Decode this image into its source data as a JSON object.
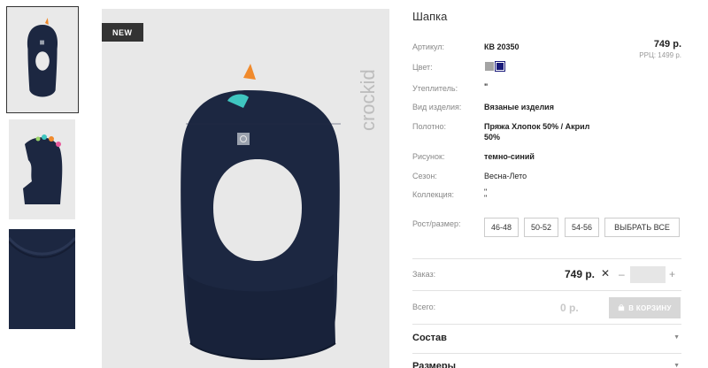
{
  "product": {
    "title": "Шапка",
    "badge": "NEW",
    "brand": "crockid",
    "price": "749 р.",
    "rrp": "РРЦ: 1499 р."
  },
  "attributes": [
    {
      "label": "Артикул:",
      "value": "КВ 20350"
    },
    {
      "label": "Цвет:",
      "value": ""
    },
    {
      "label": "Утеплитель:",
      "value": "\""
    },
    {
      "label": "Вид изделия:",
      "value": "Вязаные изделия"
    },
    {
      "label": "Полотно:",
      "value": "Пряжа Хлопок 50% / Акрил",
      "value2": "50%"
    },
    {
      "label": "Рисунок:",
      "value": "темно-синий"
    },
    {
      "label": "Сезон:",
      "value": "Весна-Лето"
    },
    {
      "label": "Коллекция:",
      "value": "\"",
      "value2": "\""
    }
  ],
  "colors": [
    {
      "name": "gray",
      "hex": "#a4a4a4"
    },
    {
      "name": "navy",
      "hex": "#1a1b7a",
      "selected": true
    }
  ],
  "sizes": {
    "label": "Рост/размер:",
    "options": [
      "46-48",
      "50-52",
      "54-56"
    ],
    "select_all": "ВЫБРАТЬ ВСЕ"
  },
  "order": {
    "label": "Заказ:",
    "price": "749 р.",
    "times": "✕",
    "minus": "–",
    "plus": "+",
    "qty": ""
  },
  "total": {
    "label": "Всего:",
    "value": "0 р.",
    "cart_button": "В КОРЗИНУ"
  },
  "sections": [
    {
      "title": "Состав",
      "chevron": "▼"
    },
    {
      "title": "Размеры",
      "chevron": "▼"
    }
  ],
  "theme": {
    "hat_color": "#1c2741",
    "background": "#e8e8e8",
    "accent_orange": "#f08a2c",
    "accent_teal": "#3fc6c0"
  }
}
